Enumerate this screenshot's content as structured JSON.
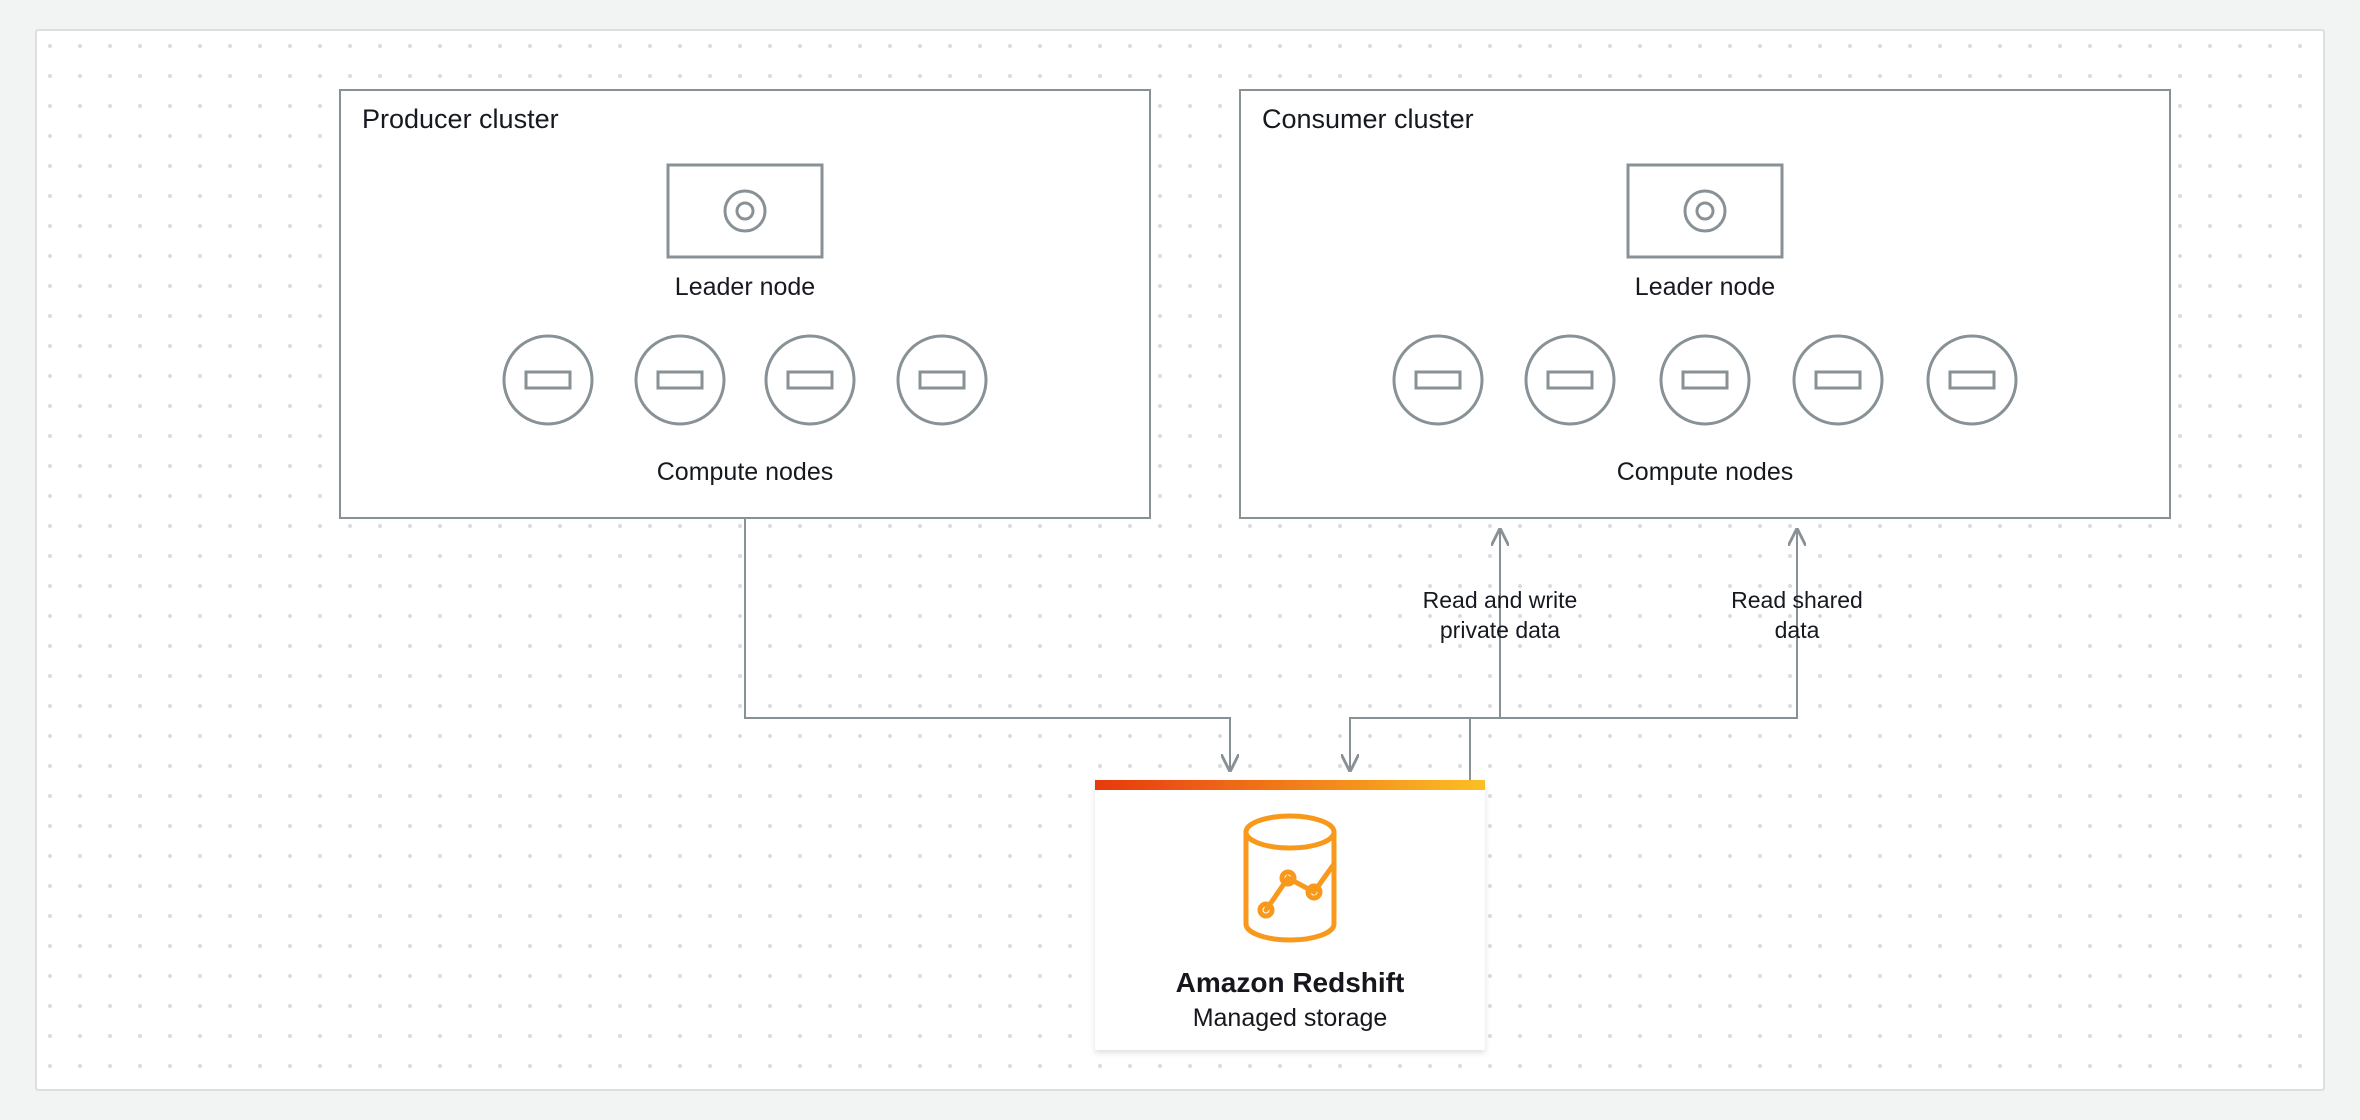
{
  "producer": {
    "title": "Producer cluster",
    "leader_label": "Leader node",
    "compute_label": "Compute nodes",
    "compute_count": 4
  },
  "consumer": {
    "title": "Consumer cluster",
    "leader_label": "Leader node",
    "compute_label": "Compute nodes",
    "compute_count": 5
  },
  "arrows": {
    "rw_private": [
      "Read and write",
      "private data"
    ],
    "read_shared": [
      "Read shared",
      "data"
    ]
  },
  "storage": {
    "title": "Amazon Redshift",
    "subtitle": "Managed storage"
  },
  "colors": {
    "bg": "#f2f3f3",
    "canvas_fill": "#ffffff",
    "canvas_stroke": "#dedfe0",
    "dot": "#d5dbdb",
    "box_stroke": "#879196",
    "node_stroke": "#879196",
    "text": "#16191f",
    "arrow": "#879196",
    "redshift_orange_dark": "#e7390e",
    "redshift_orange_light": "#fbbf25",
    "redshift_icon": "#f8991d",
    "card_shadow": "#e6e7e8"
  }
}
